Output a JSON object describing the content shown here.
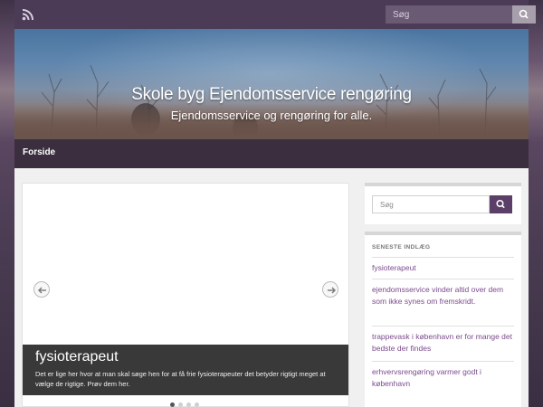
{
  "topbar": {
    "search_placeholder": "Søg"
  },
  "header": {
    "title": "Skole byg Ejendomsservice rengøring",
    "tagline": "Ejendomsservice og rengøring for alle."
  },
  "nav": {
    "items": [
      {
        "label": "Forside"
      }
    ]
  },
  "slider": {
    "caption_title": "fysioterapeut",
    "caption_text": "Det er lige her hvor at man skal søge hen for at få frie fysioterapeuter det betyder rigtigt meget at vælge de rigtige. Prøv dem her.",
    "dot_count": 4,
    "active_dot": 1
  },
  "sidebar": {
    "search_placeholder": "Søg",
    "recent_title": "SENESTE INDLÆG",
    "recent_posts": [
      "fysioterapeut",
      "ejendomsservice vinder altid over dem som ikke synes om fremskridt.",
      "trappevask i københavn er for mange det bedste der findes",
      "erhvervsrengøring varmer godt i københavn"
    ]
  },
  "colors": {
    "topbar": "#4b3b57",
    "navbar": "#3a2e3f",
    "accent_purple": "#5b3f69",
    "link": "#7b4b8d"
  }
}
